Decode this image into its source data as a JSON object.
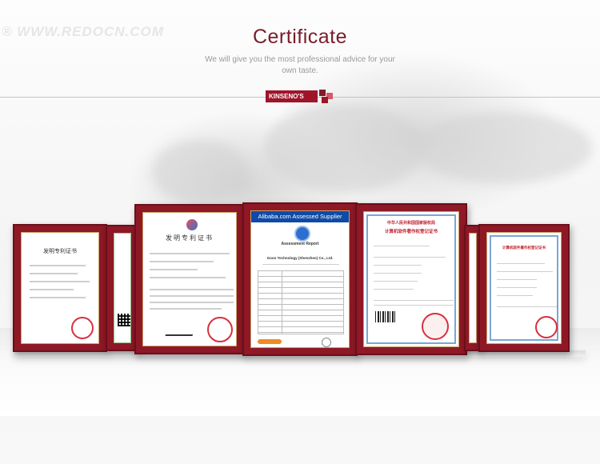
{
  "watermark": "® WWW.REDOCN.COM",
  "header": {
    "title": "Certificate",
    "subtitle": "We will give you the most professional advice for your own taste.",
    "logo_text": "KINSENO'S"
  },
  "colors": {
    "brand": "#a0142a",
    "frame": "#8e1826",
    "accent_light": "#d35a6a"
  },
  "certificates": [
    {
      "id": "left-far",
      "heading": "发明专利证书"
    },
    {
      "id": "left-near",
      "heading": ""
    },
    {
      "id": "patent",
      "heading": "发明专利证书"
    },
    {
      "id": "alibaba",
      "heading": "Alibaba.com Assessed Supplier",
      "sub": "Assessment Report",
      "company": "Goon Technology (Shenzhen) Co., Ltd."
    },
    {
      "id": "software",
      "heading": "中华人民共和国国家版权局",
      "sub": "计算机软件著作权登记证书"
    },
    {
      "id": "right-near",
      "heading": ""
    },
    {
      "id": "right-far",
      "heading": "计算机软件著作权登记证书"
    }
  ]
}
